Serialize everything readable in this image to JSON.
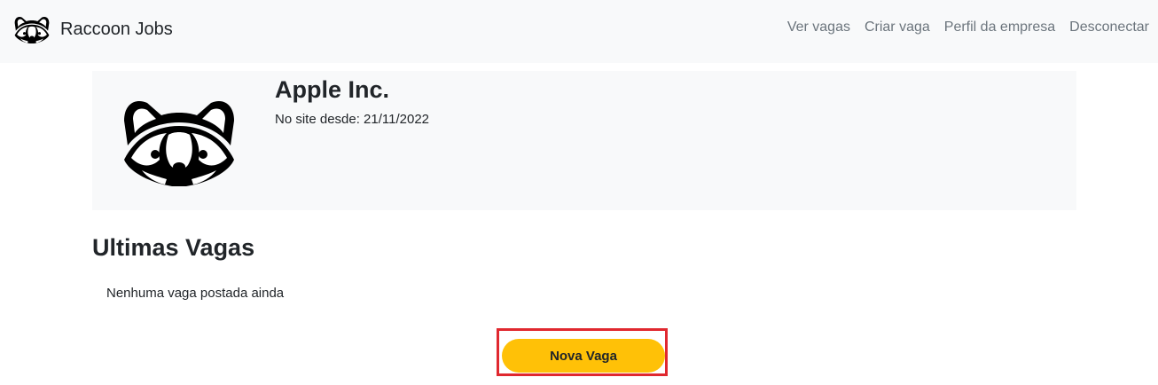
{
  "navbar": {
    "brand_name": "Raccoon Jobs",
    "brand_icon": "raccoon-icon",
    "links": [
      {
        "label": "Ver vagas"
      },
      {
        "label": "Criar vaga"
      },
      {
        "label": "Perfil da empresa"
      },
      {
        "label": "Desconectar"
      }
    ]
  },
  "company": {
    "name": "Apple Inc.",
    "member_since": "No site desde: 21/11/2022",
    "logo_icon": "raccoon-icon"
  },
  "jobs": {
    "section_title": "Ultimas Vagas",
    "empty_message": "Nenhuma vaga postada ainda",
    "new_job_button": "Nova Vaga"
  },
  "colors": {
    "navbar_bg": "#f8f9fa",
    "card_bg": "#f8f9fa",
    "button_bg": "#ffc107",
    "highlight_border": "#e0282f",
    "nav_link": "#6c757d"
  }
}
